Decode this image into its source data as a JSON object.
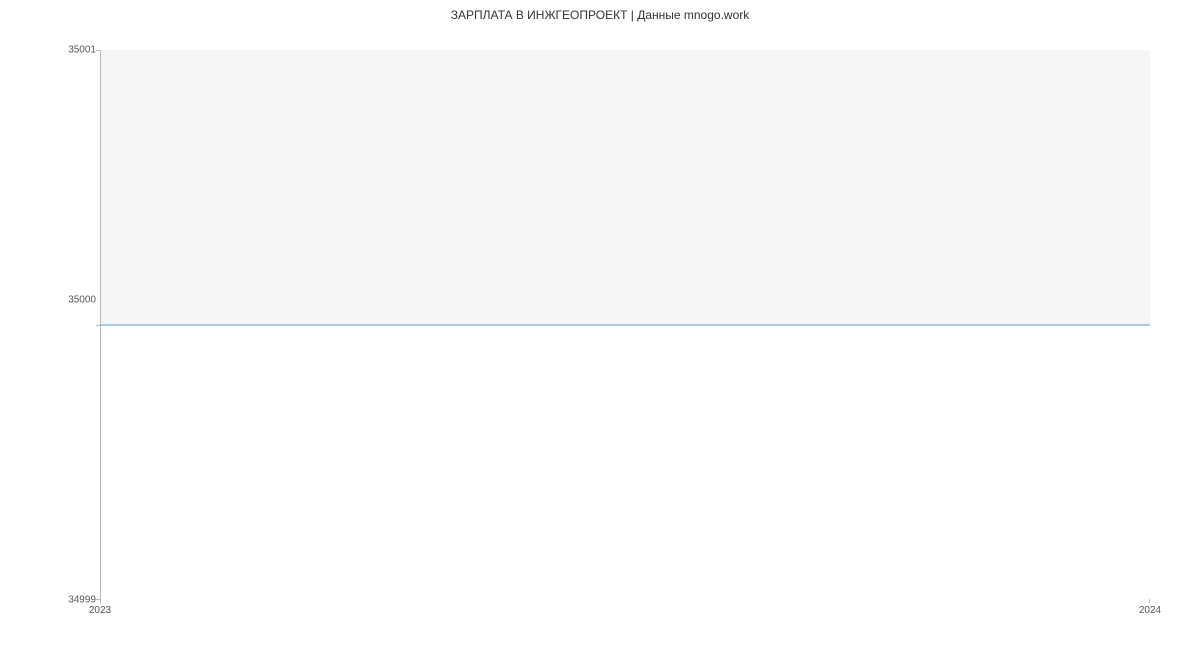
{
  "chart_data": {
    "type": "line",
    "title": "ЗАРПЛАТА В ИНЖГЕОПРОЕКТ | Данные mnogo.work",
    "x": [
      2023,
      2024
    ],
    "values": [
      35000,
      35000
    ],
    "xlabel": "",
    "ylabel": "",
    "ylim": [
      34999,
      35001
    ],
    "yticks": [
      34999,
      35000,
      35001
    ],
    "xticks": [
      2023,
      2024
    ],
    "line_color": "#5b9bd5"
  },
  "labels": {
    "ytick_top": "35001",
    "ytick_mid": "35000",
    "ytick_bot": "34999",
    "xtick_left": "2023",
    "xtick_right": "2024"
  }
}
